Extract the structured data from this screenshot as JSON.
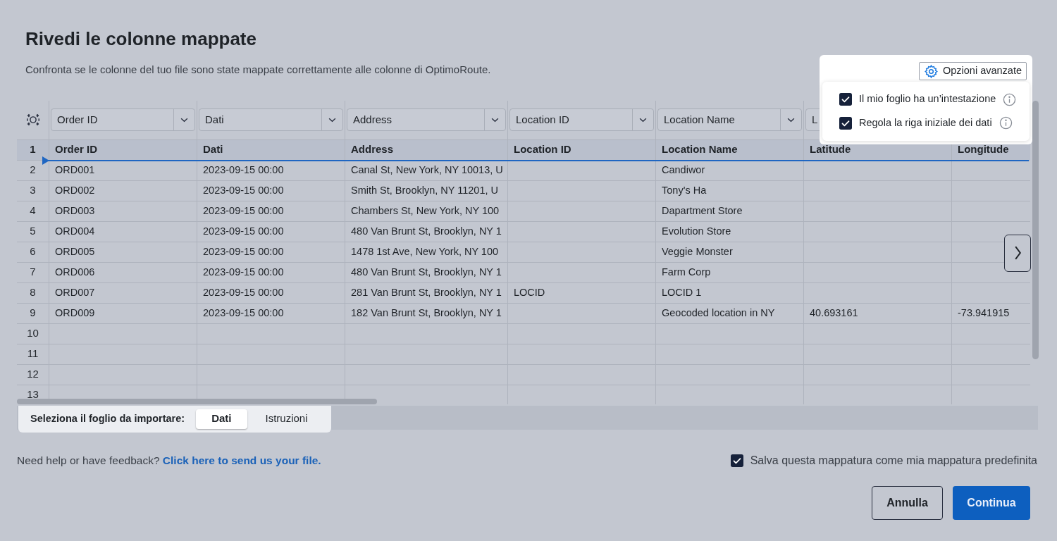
{
  "title": "Rivedi le colonne mappate",
  "subtitle": "Confronta se le colonne del tuo file sono state mappate correttamente alle colonne di OptimoRoute.",
  "advanced_options": {
    "button": "Opzioni avanzate",
    "options": [
      {
        "label": "Il mio foglio ha un’intestazione",
        "checked": true
      },
      {
        "label": "Regola la riga iniziale dei dati",
        "checked": true
      }
    ]
  },
  "mapping_dropdowns": [
    "Order ID",
    "Dati",
    "Address",
    "Location ID",
    "Location Name",
    "L"
  ],
  "table": {
    "header_row_number": "1",
    "columns": [
      "Order ID",
      "Dati",
      "Address",
      "Location ID",
      "Location Name",
      "Latitude",
      "Longitude"
    ],
    "rows": [
      {
        "number": "2",
        "cells": [
          "ORD001",
          "2023-09-15 00:00",
          "Canal St, New York, NY 10013, U",
          "",
          "Candiwor",
          "",
          ""
        ]
      },
      {
        "number": "3",
        "cells": [
          "ORD002",
          "2023-09-15 00:00",
          "Smith St, Brooklyn, NY 11201, U",
          "",
          "Tony's Ha",
          "",
          ""
        ]
      },
      {
        "number": "4",
        "cells": [
          "ORD003",
          "2023-09-15 00:00",
          "Chambers St, New York, NY 100",
          "",
          "Dapartment Store",
          "",
          ""
        ]
      },
      {
        "number": "5",
        "cells": [
          "ORD004",
          "2023-09-15 00:00",
          "480 Van Brunt St, Brooklyn, NY 1",
          "",
          "Evolution Store",
          "",
          ""
        ]
      },
      {
        "number": "6",
        "cells": [
          "ORD005",
          "2023-09-15 00:00",
          "1478 1st Ave, New York, NY 100",
          "",
          "Veggie Monster",
          "",
          ""
        ]
      },
      {
        "number": "7",
        "cells": [
          "ORD006",
          "2023-09-15 00:00",
          "480 Van Brunt St, Brooklyn, NY 1",
          "",
          "Farm Corp",
          "",
          ""
        ]
      },
      {
        "number": "8",
        "cells": [
          "ORD007",
          "2023-09-15 00:00",
          "281 Van Brunt St, Brooklyn, NY 1",
          "LOCID",
          "LOCID 1",
          "",
          ""
        ]
      },
      {
        "number": "9",
        "cells": [
          "ORD009",
          "2023-09-15 00:00",
          "182 Van Brunt St, Brooklyn, NY 1",
          "",
          "Geocoded location in NY",
          "40.693161",
          "-73.941915"
        ]
      },
      {
        "number": "10",
        "cells": []
      },
      {
        "number": "11",
        "cells": []
      },
      {
        "number": "12",
        "cells": []
      },
      {
        "number": "13",
        "cells": []
      }
    ]
  },
  "sheet_selector": {
    "label": "Seleziona il foglio da importare:",
    "tabs": [
      {
        "label": "Dati",
        "selected": true
      },
      {
        "label": "Istruzioni",
        "selected": false
      }
    ]
  },
  "help": {
    "text": "Need help or have feedback?",
    "link": "Click here to send us your file."
  },
  "save_default": {
    "label": "Salva questa mappatura come mia mappatura predefinita",
    "checked": true
  },
  "buttons": [
    {
      "label": "Annulla",
      "kind": "secondary"
    },
    {
      "label": "Continua",
      "kind": "primary"
    }
  ]
}
